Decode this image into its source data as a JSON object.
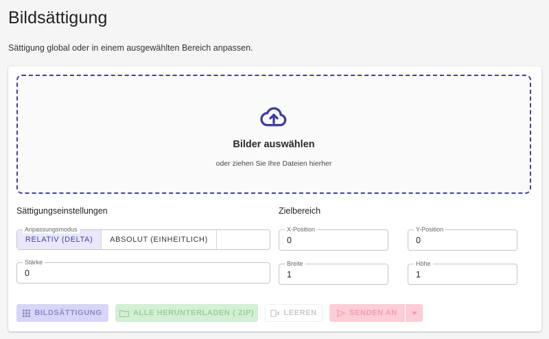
{
  "page": {
    "title": "Bildsättigung",
    "subtitle": "Sättigung global oder in einem ausgewählten Bereich anpassen."
  },
  "dropzone": {
    "icon": "cloud-upload-icon",
    "title": "Bilder auswählen",
    "hint": "oder ziehen Sie Ihre Dateien hierher"
  },
  "saturation_settings": {
    "section_title": "Sättigungseinstellungen",
    "mode_label": "Anpassungsmodus",
    "modes": [
      {
        "label": "Relativ (Delta)",
        "selected": true
      },
      {
        "label": "Absolut (Einheitlich)",
        "selected": false
      }
    ],
    "strength_label": "Stärke",
    "strength_value": "0"
  },
  "target_area": {
    "section_title": "Zielbereich",
    "x_label": "X-Position",
    "x_value": "0",
    "y_label": "Y-Position",
    "y_value": "0",
    "width_label": "Breite",
    "width_value": "1",
    "height_label": "Höhe",
    "height_value": "1"
  },
  "actions": {
    "saturation": "Bildsättigung",
    "download_all": "Alle herunterladen ( zip)",
    "clear": "Leeren",
    "send_to": "Senden an"
  },
  "colors": {
    "accent": "#3f3d9e",
    "saturation_btn": "#d7d6f6",
    "download_btn": "#d3efd4",
    "send_btn": "#fbcdd6"
  }
}
